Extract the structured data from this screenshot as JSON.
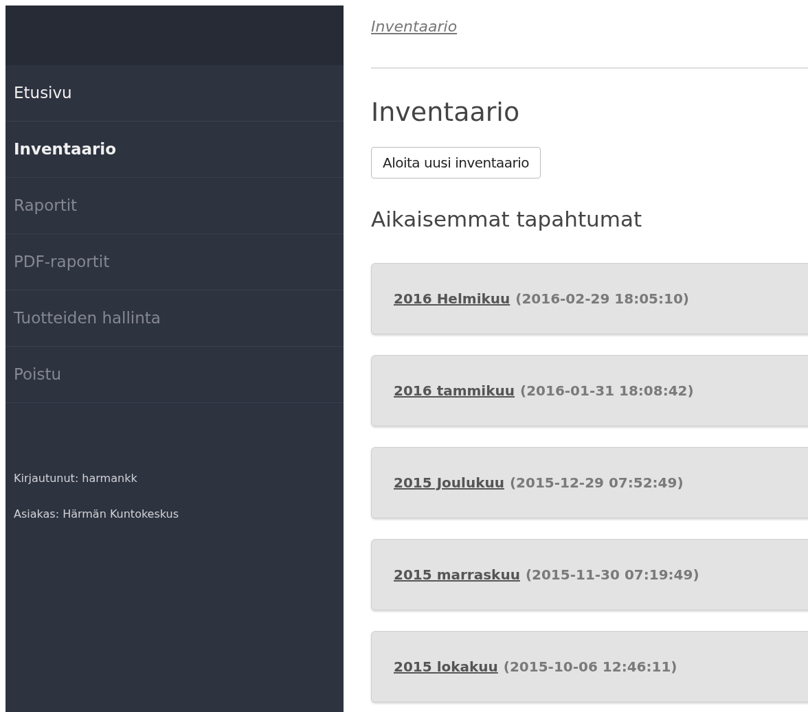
{
  "sidebar": {
    "items": [
      {
        "label": "Etusivu",
        "selected": false,
        "dimmed": false
      },
      {
        "label": "Inventaario",
        "selected": true,
        "dimmed": false
      },
      {
        "label": "Raportit",
        "selected": false,
        "dimmed": true
      },
      {
        "label": "PDF-raportit",
        "selected": false,
        "dimmed": true
      },
      {
        "label": "Tuotteiden hallinta",
        "selected": false,
        "dimmed": true
      },
      {
        "label": "Poistu",
        "selected": false,
        "dimmed": true
      }
    ],
    "user_info": [
      "Kirjautunut: harmankk",
      "Asiakas: Härmän Kuntokeskus"
    ]
  },
  "breadcrumb": "Inventaario",
  "title": "Inventaario",
  "new_button": "Aloita uusi inventaario",
  "history_heading": "Aikaisemmat tapahtumat",
  "events": [
    {
      "name": "2016 Helmikuu",
      "date": "(2016-02-29 18:05:10)"
    },
    {
      "name": "2016 tammikuu",
      "date": "(2016-01-31 18:08:42)"
    },
    {
      "name": "2015 Joulukuu",
      "date": "(2015-12-29 07:52:49)"
    },
    {
      "name": "2015 marraskuu",
      "date": "(2015-11-30 07:19:49)"
    },
    {
      "name": "2015 lokakuu",
      "date": "(2015-10-06 12:46:11)"
    }
  ]
}
